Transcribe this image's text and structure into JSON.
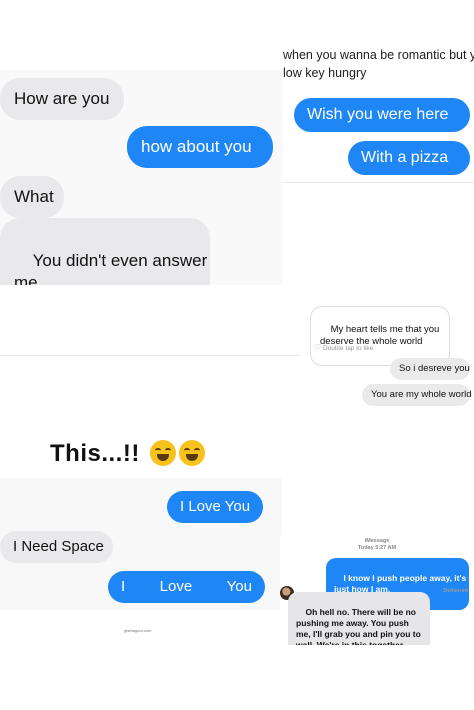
{
  "panel1": {
    "messages": [
      {
        "side": "received",
        "text": "How are you"
      },
      {
        "side": "sent",
        "text": "how about you"
      },
      {
        "side": "received",
        "text": "What"
      },
      {
        "side": "received",
        "text": "You didn't even answer\nme"
      }
    ]
  },
  "panel2": {
    "caption": "when you wanna be romantic but you\nlow key hungry",
    "messages": [
      {
        "side": "sent",
        "text": "Wish you were here"
      },
      {
        "side": "sent",
        "text": "With a pizza"
      }
    ]
  },
  "panel3": {
    "messages": [
      {
        "side": "received",
        "text": "My heart tells me that you\ndeserve the whole world"
      },
      {
        "side": "sent",
        "text": "So i desreve you"
      },
      {
        "side": "sent",
        "text": "You are my whole world"
      }
    ],
    "hint": "Double tap to like"
  },
  "panel4": {
    "title": "This...!!",
    "messages": [
      {
        "side": "sent",
        "text": "I Love You"
      },
      {
        "side": "received",
        "text": "I Need Space"
      },
      {
        "side": "sent",
        "words": [
          "I",
          "Love",
          "You"
        ]
      }
    ],
    "watermark": "gtsthagoor.com"
  },
  "panel5": {
    "service": "iMessage",
    "time": "Today 5:27 AM",
    "messages": [
      {
        "side": "sent",
        "text": "I know I push people away, it's\njust how I am."
      },
      {
        "side": "received",
        "text": "Oh hell no. There will be no\npushing me away. You push\nme, I'll grab you and pin you to\nwall. We're in this together."
      }
    ],
    "status": "Delivered"
  },
  "colors": {
    "sent_bubble": "#1f86f5",
    "received_bubble": "#e9e9eb"
  }
}
